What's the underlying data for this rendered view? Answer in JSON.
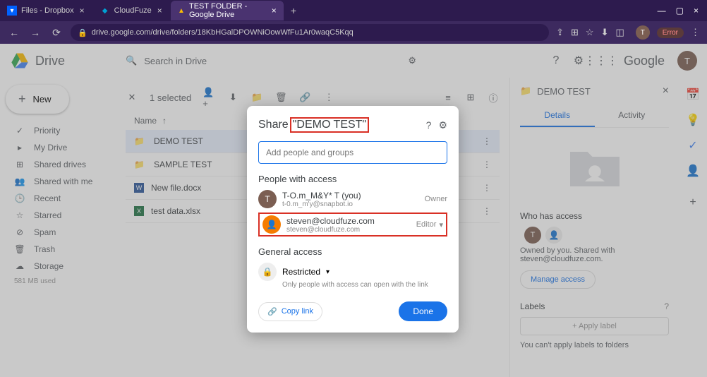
{
  "browser": {
    "tabs": [
      {
        "label": "Files - Dropbox",
        "favicon_bg": "#0061fe"
      },
      {
        "label": "CloudFuze",
        "favicon_bg": "#00a0d2"
      },
      {
        "label": "TEST FOLDER - Google Drive",
        "favicon_bg": "#4285f4"
      }
    ],
    "url": "drive.google.com/drive/folders/18KbHGalDPOWNiOowWfFu1Ar0waqC5Kqq",
    "error_label": "Error"
  },
  "header": {
    "app_name": "Drive",
    "search_placeholder": "Search in Drive",
    "brand": "Google",
    "avatar_letter": "T"
  },
  "sidebar": {
    "new_label": "New",
    "items": [
      {
        "label": "Priority"
      },
      {
        "label": "My Drive"
      },
      {
        "label": "Shared drives"
      },
      {
        "label": "Shared with me"
      },
      {
        "label": "Recent"
      },
      {
        "label": "Starred"
      },
      {
        "label": "Spam"
      },
      {
        "label": "Trash"
      },
      {
        "label": "Storage"
      }
    ],
    "storage_used": "581 MB used"
  },
  "toolbar": {
    "selected_text": "1 selected"
  },
  "columns": {
    "name": "Name"
  },
  "files": [
    {
      "name": "DEMO TEST",
      "type": "folder"
    },
    {
      "name": "SAMPLE TEST",
      "type": "folder"
    },
    {
      "name": "New file.docx",
      "type": "docx"
    },
    {
      "name": "test data.xlsx",
      "type": "xlsx"
    }
  ],
  "details": {
    "title": "DEMO TEST",
    "tabs": {
      "details": "Details",
      "activity": "Activity"
    },
    "who_has_access": "Who has access",
    "owned_text": "Owned by you. Shared with steven@cloudfuze.com.",
    "manage_access": "Manage access",
    "labels": "Labels",
    "apply_label": "+   Apply label",
    "cant_apply": "You can't apply labels to folders"
  },
  "modal": {
    "title_prefix": "Share ",
    "title_name": "\"DEMO TEST\"",
    "add_placeholder": "Add people and groups",
    "people_header": "People with access",
    "owner": {
      "name": "T-O.m_M&Y* T (you)",
      "email": "t-0.m_m'y@snapbot.io",
      "role": "Owner",
      "avatar_bg": "#7b5e52",
      "avatar_letter": "T"
    },
    "shared": {
      "name": "steven@cloudfuze.com",
      "email": "steven@cloudfuze.com",
      "role": "Editor",
      "avatar_bg": "#f57c00"
    },
    "general_header": "General access",
    "restricted_label": "Restricted",
    "restricted_sub": "Only people with access can open with the link",
    "copy_link": "Copy link",
    "done": "Done"
  }
}
